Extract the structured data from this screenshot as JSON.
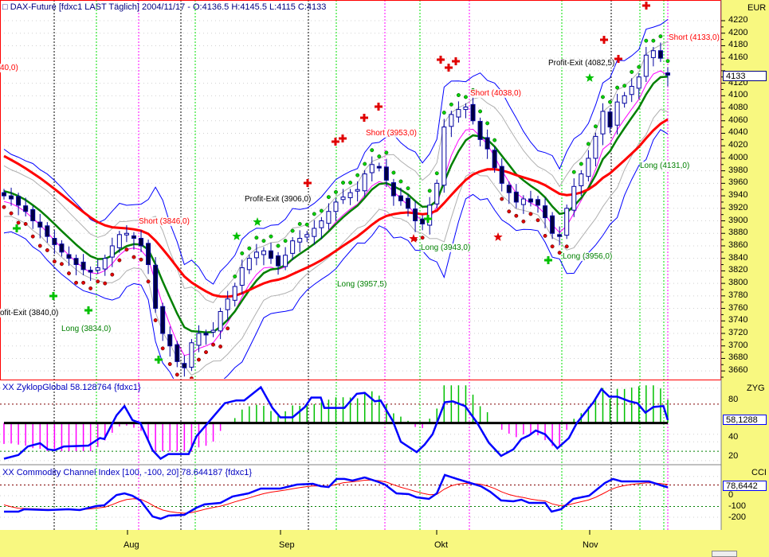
{
  "header": {
    "title": "DAX-Future [fdxc1 LAST Täglich] 2004/11/17 - O:4136.5 H:4145.5 L:4115 C:4133"
  },
  "price_axis": {
    "unit": "EUR",
    "ticks": [
      "4220",
      "4200",
      "4180",
      "4160",
      "4120",
      "4100",
      "4080",
      "4060",
      "4040",
      "4020",
      "4000",
      "3980",
      "3960",
      "3940",
      "3920",
      "3900",
      "3880",
      "3860",
      "3840",
      "3820",
      "3800",
      "3780",
      "3760",
      "3740",
      "3720",
      "3700",
      "3680",
      "3660"
    ],
    "current_label": "4133"
  },
  "annotations": [
    {
      "text": "40,0)",
      "kind": "short"
    },
    {
      "text": "ofit-Exit (3840,0)",
      "kind": "exit"
    },
    {
      "text": "Long (3834,0)",
      "kind": "long"
    },
    {
      "text": "Short (3846,0)",
      "kind": "short"
    },
    {
      "text": "Profit-Exit (3906,0)",
      "kind": "exit"
    },
    {
      "text": "Short (3953,0)",
      "kind": "short"
    },
    {
      "text": "Long (3957,5)",
      "kind": "long"
    },
    {
      "text": "Long (3943,0)",
      "kind": "long"
    },
    {
      "text": "Short (4038,0)",
      "kind": "short"
    },
    {
      "text": "Profit-Exit (4082,5)",
      "kind": "exit"
    },
    {
      "text": "Long (3956,0)",
      "kind": "long"
    },
    {
      "text": "Long (4131,0)",
      "kind": "long"
    },
    {
      "text": "Short (4133,0)",
      "kind": "short"
    }
  ],
  "zyg_panel": {
    "title": "XX ZyklopGlobal 58.128764 {fdxc1}",
    "axis_name": "ZYG",
    "ticks": [
      "80",
      "40",
      "20"
    ],
    "current_label": "58,1288"
  },
  "cci_panel": {
    "title": "XX Commodity Channel Index [100, -100, 20] 78.644187 {fdxc1}",
    "axis_name": "CCI",
    "ticks": [
      "0",
      "-100",
      "-200"
    ],
    "current_label": "78,6442"
  },
  "date_axis": {
    "months": [
      "Aug",
      "Sep",
      "Okt",
      "Nov"
    ]
  },
  "colors": {
    "axis_bg": "#f8f880",
    "up": "#ffffff",
    "down": "#000040",
    "wick": "#0000a0",
    "slow_ma": "#ff0000",
    "fast_ma": "#008000",
    "band": "#0000ff",
    "frame": "#ff0000"
  },
  "chart_data": [
    {
      "type": "candlestick",
      "title": "DAX-Future [fdxc1 LAST Täglich]",
      "ylabel": "EUR",
      "ylim": [
        3650,
        4230
      ],
      "x": "trading day index (Jul–Nov 17, 2004)",
      "close": [
        3940,
        3935,
        3925,
        3915,
        3900,
        3890,
        3875,
        3862,
        3850,
        3840,
        3830,
        3822,
        3818,
        3825,
        3840,
        3860,
        3878,
        3880,
        3872,
        3860,
        3830,
        3760,
        3720,
        3700,
        3675,
        3665,
        3705,
        3720,
        3718,
        3725,
        3755,
        3775,
        3795,
        3825,
        3840,
        3850,
        3852,
        3840,
        3828,
        3845,
        3868,
        3872,
        3878,
        3888,
        3900,
        3915,
        3930,
        3938,
        3945,
        3950,
        3975,
        3990,
        3985,
        3965,
        3940,
        3932,
        3920,
        3900,
        3895,
        3925,
        3960,
        4050,
        4070,
        4078,
        4082,
        4060,
        4030,
        4015,
        3985,
        3960,
        3945,
        3930,
        3935,
        3930,
        3925,
        3905,
        3880,
        3875,
        3920,
        3955,
        3975,
        4000,
        4035,
        4075,
        4050,
        4090,
        4100,
        4115,
        4130,
        4165,
        4172,
        4160,
        4133
      ],
      "last_bar": {
        "open": 4136.5,
        "high": 4145.5,
        "low": 4115,
        "close": 4133
      }
    },
    {
      "type": "line",
      "title": "XX ZyklopGlobal",
      "ylim": [
        0,
        100
      ],
      "points": [
        [
          0,
          17
        ],
        [
          2,
          21
        ],
        [
          3.3,
          30
        ],
        [
          5,
          33.5
        ],
        [
          6.1,
          27
        ],
        [
          7,
          26
        ],
        [
          8.3,
          30
        ],
        [
          11.7,
          31
        ],
        [
          13.3,
          39
        ],
        [
          13.9,
          38
        ],
        [
          15.6,
          63
        ],
        [
          16.7,
          73
        ],
        [
          17.8,
          58
        ],
        [
          18.9,
          55
        ],
        [
          20.6,
          26
        ],
        [
          21.7,
          17
        ],
        [
          22.8,
          22
        ],
        [
          25.6,
          22
        ],
        [
          26.7,
          41
        ],
        [
          28.6,
          58
        ],
        [
          30.6,
          76
        ],
        [
          32.2,
          79
        ],
        [
          33.3,
          79
        ],
        [
          35.6,
          93
        ],
        [
          37.2,
          71
        ],
        [
          38.3,
          61
        ],
        [
          40,
          61
        ],
        [
          41.7,
          72
        ],
        [
          42.6,
          82
        ],
        [
          43.9,
          82
        ],
        [
          44.4,
          71
        ],
        [
          47.2,
          71
        ],
        [
          48.9,
          86
        ],
        [
          50,
          87
        ],
        [
          51.4,
          78
        ],
        [
          52.2,
          79
        ],
        [
          53.9,
          57
        ],
        [
          55,
          35
        ],
        [
          57.2,
          24
        ],
        [
          58.3,
          32
        ],
        [
          59.4,
          43
        ],
        [
          61.1,
          77
        ],
        [
          62.2,
          78
        ],
        [
          63.9,
          73
        ],
        [
          65.6,
          55
        ],
        [
          67.2,
          34
        ],
        [
          68.9,
          20
        ],
        [
          70.6,
          27
        ],
        [
          71.7,
          38
        ],
        [
          72.8,
          42
        ],
        [
          73.7,
          47
        ],
        [
          75,
          43
        ],
        [
          76.7,
          28
        ],
        [
          78.3,
          39
        ],
        [
          79.4,
          55
        ],
        [
          81.7,
          77
        ],
        [
          82.8,
          91
        ],
        [
          83.9,
          83
        ],
        [
          85,
          83
        ],
        [
          86.7,
          78
        ],
        [
          87.8,
          76
        ],
        [
          88.9,
          66
        ],
        [
          90,
          72
        ],
        [
          91.4,
          73
        ],
        [
          92,
          58.13
        ]
      ],
      "baseline": 55,
      "upper_level": 75,
      "lower_level": 25,
      "last_value": 58.128764
    },
    {
      "type": "line",
      "title": "XX Commodity Channel Index [100, -100, 20]",
      "ylim": [
        -300,
        300
      ],
      "points": [
        [
          0,
          -148
        ],
        [
          2,
          -148
        ],
        [
          2.8,
          -126
        ],
        [
          6.1,
          -133
        ],
        [
          8.9,
          -126
        ],
        [
          10.5,
          -133
        ],
        [
          12.8,
          -96
        ],
        [
          13.9,
          -89
        ],
        [
          15.6,
          7
        ],
        [
          16.7,
          22
        ],
        [
          17.8,
          0
        ],
        [
          18.9,
          -44
        ],
        [
          20.6,
          -193
        ],
        [
          21.7,
          -215
        ],
        [
          22.8,
          -185
        ],
        [
          25,
          -178
        ],
        [
          26.7,
          -111
        ],
        [
          27.8,
          -81
        ],
        [
          30,
          -67
        ],
        [
          31.7,
          -7
        ],
        [
          33.9,
          22
        ],
        [
          35.6,
          67
        ],
        [
          38.3,
          67
        ],
        [
          40.6,
          104
        ],
        [
          42.8,
          111
        ],
        [
          43.9,
          89
        ],
        [
          45,
          81
        ],
        [
          46.1,
          156
        ],
        [
          47.2,
          156
        ],
        [
          48.3,
          141
        ],
        [
          50,
          170
        ],
        [
          51.7,
          133
        ],
        [
          52.8,
          104
        ],
        [
          54.4,
          22
        ],
        [
          56.1,
          15
        ],
        [
          57.2,
          -15
        ],
        [
          58.9,
          -30
        ],
        [
          60,
          22
        ],
        [
          61.1,
          193
        ],
        [
          62.8,
          156
        ],
        [
          65,
          111
        ],
        [
          66.1,
          89
        ],
        [
          67.4,
          37
        ],
        [
          68.9,
          -44
        ],
        [
          70.6,
          -52
        ],
        [
          71.7,
          -37
        ],
        [
          72.8,
          -67
        ],
        [
          75,
          -67
        ],
        [
          75.9,
          -148
        ],
        [
          77.2,
          -126
        ],
        [
          78.9,
          -30
        ],
        [
          81.1,
          0
        ],
        [
          82.2,
          59
        ],
        [
          83.3,
          119
        ],
        [
          84.4,
          156
        ],
        [
          85.6,
          133
        ],
        [
          89.4,
          133
        ],
        [
          91.1,
          96
        ],
        [
          92,
          78.64
        ]
      ],
      "levels": [
        100,
        -100
      ],
      "last_value": 78.644187
    }
  ]
}
